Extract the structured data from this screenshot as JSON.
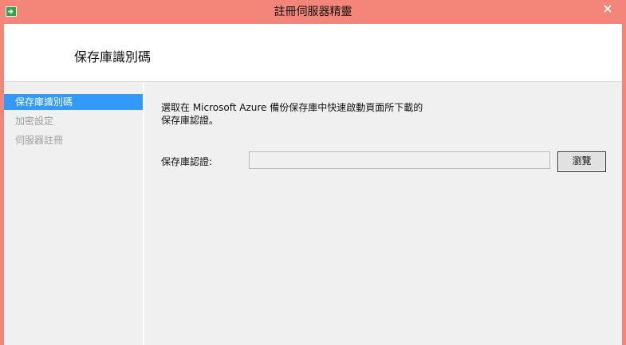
{
  "window": {
    "title": "註冊伺服器精靈",
    "accent_color": "#f4857a"
  },
  "header": {
    "page_title": "保存庫識別碼"
  },
  "sidebar": {
    "items": [
      {
        "label": "保存庫識別碼",
        "state": "active"
      },
      {
        "label": "加密設定",
        "state": "disabled"
      },
      {
        "label": "伺服器註冊",
        "state": "disabled"
      }
    ],
    "selection_color": "#3399ff"
  },
  "main": {
    "instruction_line1": "選取在 Microsoft Azure 備份保存庫中快速啟動頁面所下載的",
    "instruction_line2": "保存庫認證。",
    "credentials_label": "保存庫認證:",
    "credentials_value": "",
    "browse_label": "瀏覽"
  },
  "icons": {
    "app": "green-arrow-icon",
    "close": "close-icon"
  }
}
